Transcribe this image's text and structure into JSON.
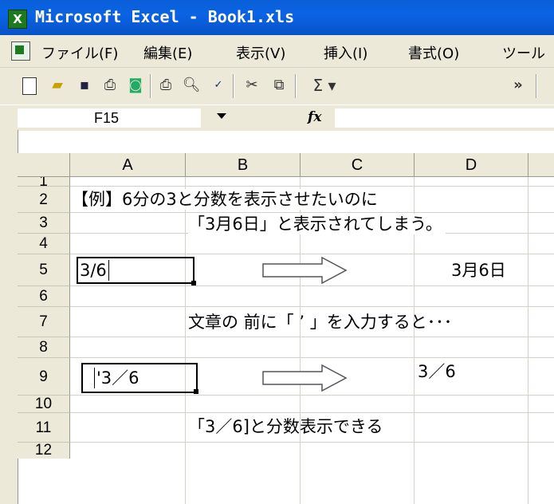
{
  "window": {
    "title": "Microsoft Excel - Book1.xls",
    "app_icon_glyph": "X"
  },
  "menu": [
    "ファイル(F)",
    "編集(E)",
    "表示(V)",
    "挿入(I)",
    "書式(O)",
    "ツール"
  ],
  "toolbar": {
    "icons": [
      "new-icon",
      "open-icon",
      "save-icon",
      "permission-icon",
      "research-icon",
      "print-icon",
      "print-preview-icon",
      "spelling-icon",
      "cut-icon",
      "copy-icon",
      "autosum-icon",
      "more-options-icon"
    ],
    "sum_glyph": "Σ ▾",
    "more_glyph": "»"
  },
  "formula_bar": {
    "name_box": "F15",
    "fx_label": "fx",
    "content": ""
  },
  "columns": [
    "A",
    "B",
    "C",
    "D"
  ],
  "rows": [
    "1",
    "2",
    "3",
    "4",
    "5",
    "6",
    "7",
    "8",
    "9",
    "10",
    "11",
    "12"
  ],
  "cells": {
    "a2": "【例】6分の3と分数を表示させたいのに",
    "b3": "「3月6日」と表示されてしまう。",
    "a5": "3/6",
    "d5": "3月6日",
    "b7": "文章の 前に「 ’ 」を入力すると･･･",
    "a9": "'3／6",
    "d9": "3／6",
    "b11": "「3／6]と分数表示できる"
  },
  "colors": {
    "titlebar": "#0b63e5",
    "chrome": "#ece9d8",
    "gridline": "#d4d0c8"
  }
}
